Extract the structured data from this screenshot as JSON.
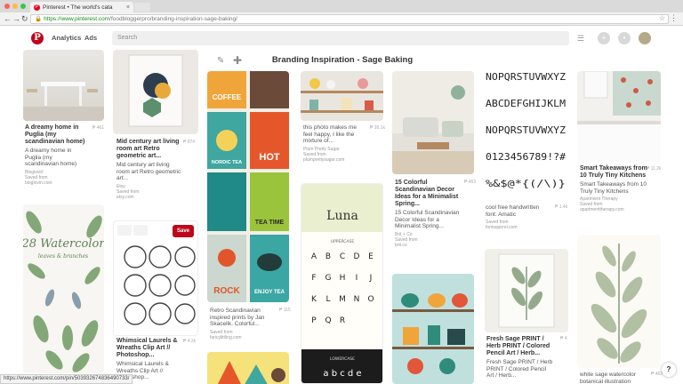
{
  "browser": {
    "tab_title": "Pinterest • The world's cata",
    "tab_close": "×",
    "url_host": "https://www.pinterest.com",
    "url_path": "/foodbloggerpro/branding-inspiration-sage-baking/"
  },
  "header": {
    "analytics": "Analytics",
    "ads": "Ads",
    "search_placeholder": "Search"
  },
  "board": {
    "title": "Branding Inspiration - Sage Baking"
  },
  "pins": {
    "p1": {
      "title": "A dreamy home in Puglia (my scandinavian home)",
      "desc": "A dreamy home in Puglia (my scandinavian home)",
      "src1": "Blogiovin'",
      "src2": "Saved from",
      "src3": "bloglovin.com",
      "count": "₱ 461"
    },
    "p2": {
      "title": "Mid century art living room art Retro geometric art...",
      "desc": "Mid century art living room art Retro geometric art...",
      "src1": "Etsy",
      "src2": "Saved from",
      "src3": "etsy.com",
      "count": "₱ 874"
    },
    "p3": {
      "title": "Whimsical Laurels & Wreaths Clip Art // Photoshop...",
      "desc": "Whimsical Laurels & Wreaths Clip Art // Photoshop...",
      "count": "₱ 4.2k"
    },
    "p4": {
      "title": "Retro Scandinavian inspired prints by Jan Skacelik. Colorful...",
      "src1": "Saved from",
      "src2": "fancylittling.com",
      "count": "₱ 115"
    },
    "p5": {
      "title": "this photo makes me feel happy, I like the mixture of...",
      "src1": "Plum Pretty Sugar",
      "src2": "Saved from",
      "src3": "plumprettysugar.com",
      "count": "₱ 26.1k"
    },
    "p6": {
      "title": "15 Colorful Scandinavian Decor Ideas for a Minimalist Spring...",
      "desc": "15 Colorful Scandinavian Decor Ideas for a Minimalist Spring...",
      "src1": "Brit + Co",
      "src2": "Saved from",
      "src3": "brit.co",
      "count": "₱ 453"
    },
    "p7": {
      "title": "cool free handwritten font: Amatic",
      "src1": "Saved from",
      "src2": "fontsquirrel.com",
      "count": "₱ 1.4k"
    },
    "p8": {
      "title": "Smart Takeaways from 10 Truly Tiny Kitchens",
      "desc": "Smart Takeaways from 10 Truly Tiny Kitchens",
      "src1": "Apartment Therapy",
      "src2": "Saved from",
      "src3": "apartmenttherapy.com",
      "count": "₱ 11.2k"
    },
    "p9": {
      "title": "Fresh Sage PRINT / Herb PRINT / Colored Pencil Art / Herb...",
      "desc": "Fresh Sage PRINT / Herb PRINT / Colored Pencil Art / Herb...",
      "count": "₱ 4"
    },
    "p10": {
      "desc": "white sage watercolor botanical illustration",
      "count": "₱ 463"
    },
    "p11": {
      "title": "28 Watercolor"
    }
  },
  "art": {
    "coffee": "COFFEE",
    "nordic": "NORDIC TEA",
    "hot": "HOT",
    "teatime": "TEA TIME",
    "rock": "ROCK",
    "enjoy": "ENJOY TEA",
    "luna": "Luna",
    "uppercase": "UPPERCASE",
    "lowercase": "LOWERCASE",
    "letters": [
      "A",
      "B",
      "C",
      "D",
      "E",
      "F",
      "G",
      "H",
      "I",
      "J",
      "K",
      "L",
      "M",
      "N",
      "O",
      "P",
      "Q",
      "R"
    ],
    "lower": "a b c d e",
    "font_lines": [
      "NOPQRSTUVWXYZ",
      "ABCDEFGHIJKLM",
      "NOPQRSTUVWXYZ",
      "0123456789!?#",
      "%&$@*{(/\\)}"
    ],
    "watercolor": "28 Watercolor leaves & branches",
    "save": "Save"
  },
  "status_url": "https://www.pinterest.com/pin/503932674836490733/",
  "help": "?"
}
